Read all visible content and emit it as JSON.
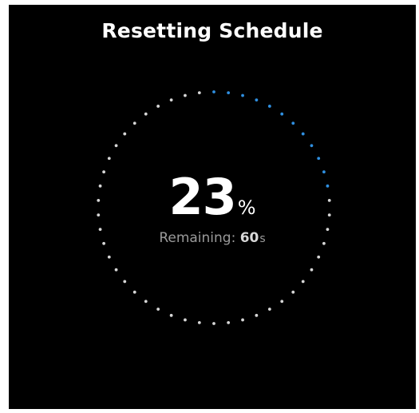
{
  "title": "Resetting Schedule",
  "progress": {
    "percent": 23,
    "percent_text": "23",
    "percent_sign": "%",
    "remaining_label": "Remaining: ",
    "remaining_value": "60",
    "remaining_unit": "s"
  },
  "ring": {
    "dot_count": 50,
    "active_color": "#2f8fe0",
    "inactive_color": "#d6d6d6",
    "background": "#000000"
  }
}
